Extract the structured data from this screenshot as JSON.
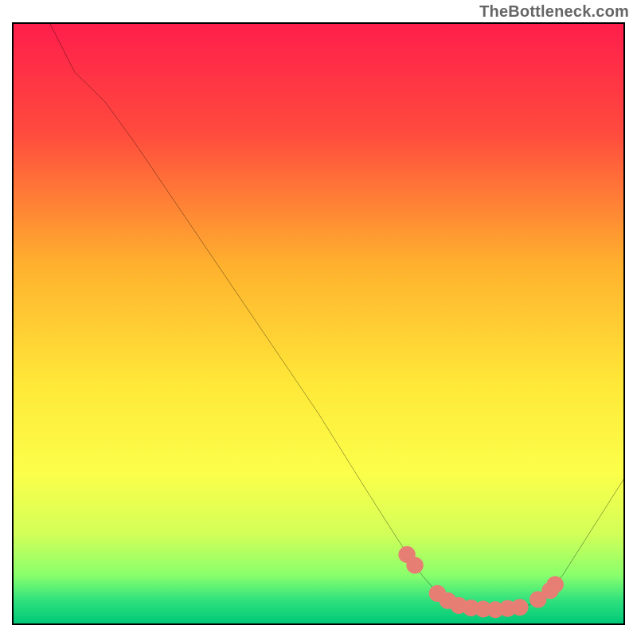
{
  "watermark": "TheBottleneck.com",
  "chart_data": {
    "type": "line",
    "title": "",
    "xlabel": "",
    "ylabel": "",
    "xlim": [
      0,
      100
    ],
    "ylim": [
      100,
      0
    ],
    "gradient_stops": [
      {
        "offset": 0,
        "color": "#ff1e4b"
      },
      {
        "offset": 18,
        "color": "#ff4a3e"
      },
      {
        "offset": 40,
        "color": "#ffb02e"
      },
      {
        "offset": 60,
        "color": "#ffe838"
      },
      {
        "offset": 75,
        "color": "#fbff4a"
      },
      {
        "offset": 85,
        "color": "#d3ff58"
      },
      {
        "offset": 92,
        "color": "#89ff6c"
      },
      {
        "offset": 96,
        "color": "#32e27d"
      },
      {
        "offset": 100,
        "color": "#00c878"
      }
    ],
    "curve": [
      {
        "x": 6,
        "y": 0
      },
      {
        "x": 10,
        "y": 8
      },
      {
        "x": 15,
        "y": 13
      },
      {
        "x": 20,
        "y": 20
      },
      {
        "x": 30,
        "y": 35
      },
      {
        "x": 40,
        "y": 50
      },
      {
        "x": 50,
        "y": 65
      },
      {
        "x": 58,
        "y": 78
      },
      {
        "x": 63,
        "y": 86
      },
      {
        "x": 67,
        "y": 92
      },
      {
        "x": 70,
        "y": 95.5
      },
      {
        "x": 73,
        "y": 97
      },
      {
        "x": 76,
        "y": 97.6
      },
      {
        "x": 80,
        "y": 97.8
      },
      {
        "x": 84,
        "y": 97.2
      },
      {
        "x": 87,
        "y": 95.5
      },
      {
        "x": 90,
        "y": 92
      },
      {
        "x": 95,
        "y": 84
      },
      {
        "x": 100,
        "y": 76
      }
    ],
    "markers": [
      {
        "x": 64.5,
        "y": 88.5
      },
      {
        "x": 65.8,
        "y": 90.3
      },
      {
        "x": 69.5,
        "y": 95.0
      },
      {
        "x": 71.2,
        "y": 96.2
      },
      {
        "x": 73.0,
        "y": 97.0
      },
      {
        "x": 75.0,
        "y": 97.4
      },
      {
        "x": 77.0,
        "y": 97.6
      },
      {
        "x": 79.0,
        "y": 97.7
      },
      {
        "x": 81.0,
        "y": 97.5
      },
      {
        "x": 83.0,
        "y": 97.3
      },
      {
        "x": 86.0,
        "y": 96.0
      },
      {
        "x": 88.0,
        "y": 94.5
      },
      {
        "x": 88.8,
        "y": 93.5
      }
    ],
    "marker_color": "#e77e74",
    "marker_r": 1.4
  }
}
